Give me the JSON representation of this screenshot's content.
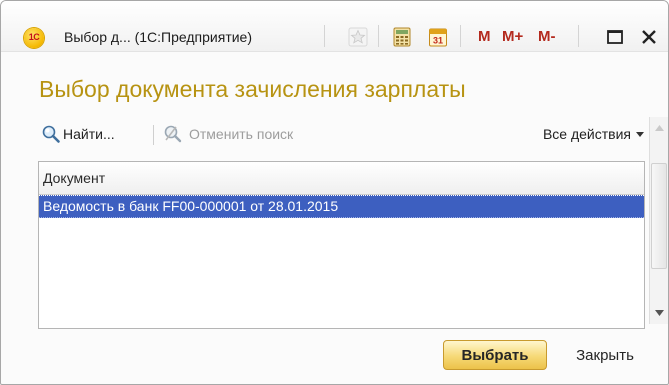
{
  "window": {
    "title": "Выбор д...  (1С:Предприятие)",
    "logo_text": "1С",
    "toolbar": {
      "m_label": "M",
      "mplus_label": "M+",
      "mminus_label": "M-",
      "calendar_day": "31"
    }
  },
  "form": {
    "title": "Выбор документа зачисления зарплаты"
  },
  "command_bar": {
    "find_label": "Найти...",
    "cancel_search_label": "Отменить поиск",
    "all_actions_label": "Все действия"
  },
  "table": {
    "columns": [
      "Документ"
    ],
    "rows": [
      {
        "document": "Ведомость в банк FF00-000001 от 28.01.2015",
        "selected": true
      }
    ]
  },
  "buttons": {
    "select_label": "Выбрать",
    "close_label": "Закрыть"
  },
  "colors": {
    "title_accent": "#b79312",
    "selection": "#3d5fc0",
    "default_button": "#f6d977"
  }
}
